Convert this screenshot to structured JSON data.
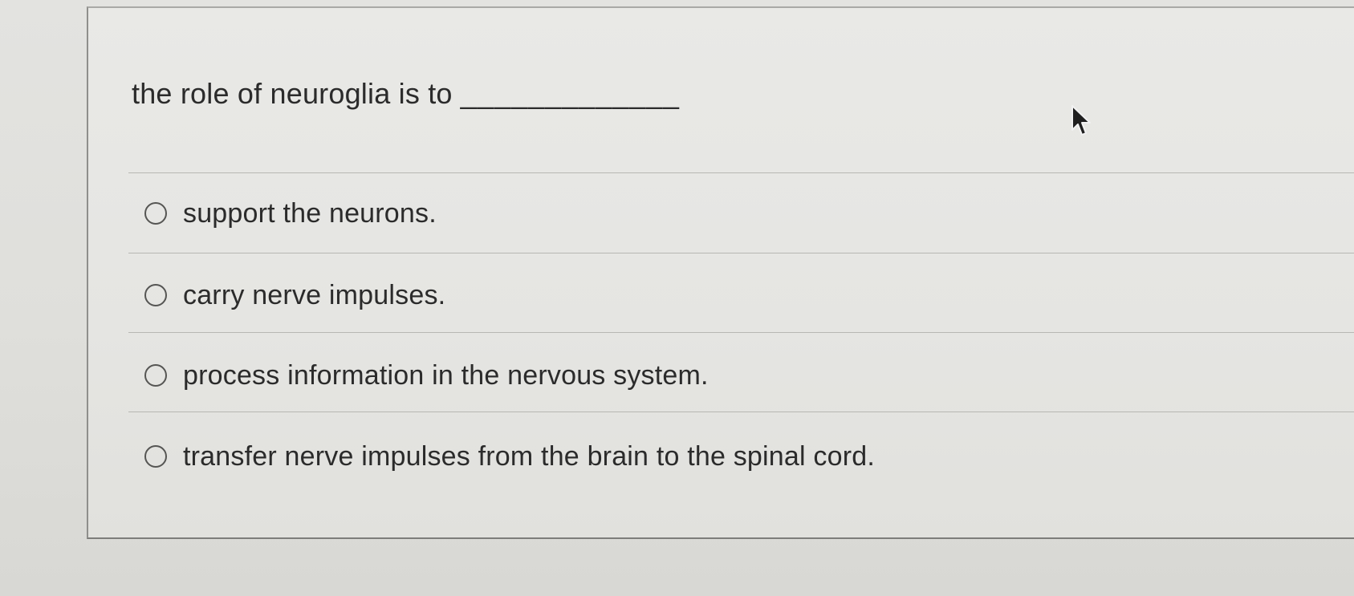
{
  "question": {
    "text": "the role of neuroglia is to",
    "blank": "_____________"
  },
  "options": [
    {
      "label": "support the neurons."
    },
    {
      "label": "carry nerve impulses."
    },
    {
      "label": "process information in the nervous system."
    },
    {
      "label": "transfer nerve impulses from the brain to the spinal cord."
    }
  ],
  "cursor": {
    "icon": "mouse-pointer-icon"
  }
}
